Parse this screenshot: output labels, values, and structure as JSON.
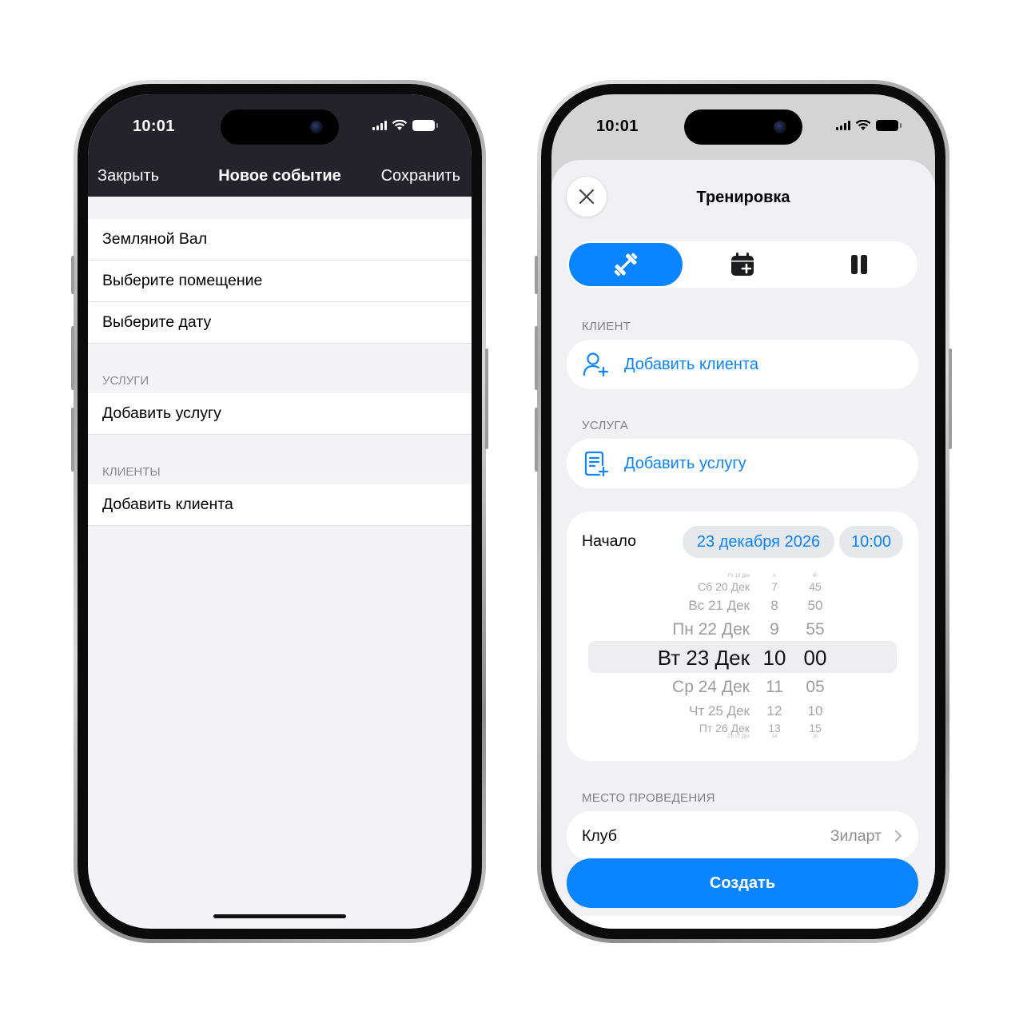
{
  "left": {
    "status_time": "10:01",
    "nav": {
      "close_label": "Закрыть",
      "title": "Новое событие",
      "save_label": "Сохранить"
    },
    "rows": [
      "Земляной Вал",
      "Выберите помещение",
      "Выберите дату"
    ],
    "services_header": "УСЛУГИ",
    "add_service": "Добавить услугу",
    "clients_header": "КЛИЕНТЫ",
    "add_client": "Добавить клиента"
  },
  "right": {
    "status_time": "10:01",
    "title": "Тренировка",
    "segments": [
      {
        "icon": "dumbbell-icon",
        "active": true
      },
      {
        "icon": "calendar-plus-icon",
        "active": false
      },
      {
        "icon": "pause-icon",
        "active": false
      }
    ],
    "client_label": "КЛИЕНТ",
    "add_client": "Добавить клиента",
    "service_label": "УСЛУГА",
    "add_service": "Добавить услугу",
    "start_label": "Начало",
    "start_date": "23 декабря 2026",
    "start_time": "10:00",
    "picker": {
      "dates": [
        "Пт 19 Дек",
        "Сб 20 Дек",
        "Вс 21 Дек",
        "Пн 22 Дек",
        "Вт 23 Дек",
        "Ср 24 Дек",
        "Чт 25 Дек",
        "Пт 26 Дек",
        "Сб 27 Дек"
      ],
      "hours": [
        "6",
        "7",
        "8",
        "9",
        "10",
        "11",
        "12",
        "13",
        "14"
      ],
      "minutes": [
        "40",
        "45",
        "50",
        "55",
        "00",
        "05",
        "10",
        "15",
        "20"
      ],
      "selected_index": 4
    },
    "venue_label": "МЕСТО ПРОВЕДЕНИЯ",
    "club_label": "Клуб",
    "club_value": "Зиларт",
    "create_label": "Создать"
  },
  "colors": {
    "accent": "#0a84ff",
    "dark_nav": "#24222a",
    "sheet_bg": "#f1f1f4"
  }
}
